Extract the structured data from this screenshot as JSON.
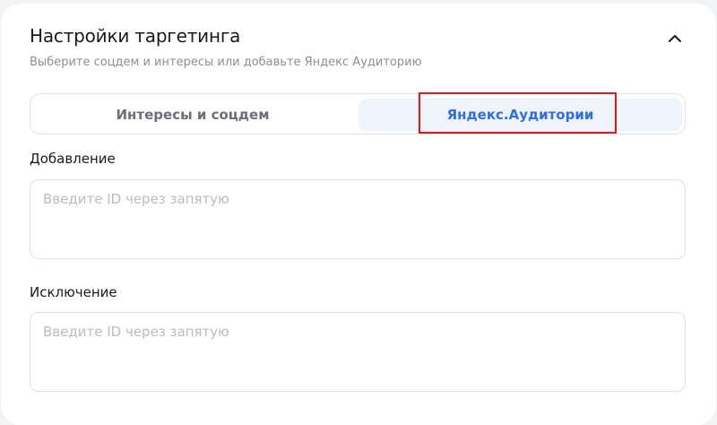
{
  "section": {
    "title": "Настройки таргетинга",
    "subtitle": "Выберите соцдем и интересы или добавьте Яндекс Аудиторию",
    "collapse_icon": "chevron-up-icon"
  },
  "tabs": [
    {
      "label": "Интересы и соцдем",
      "selected": false
    },
    {
      "label": "Яндекс.Аудитории",
      "selected": true
    }
  ],
  "fields": {
    "add": {
      "label": "Добавление",
      "placeholder": "Введите ID через запятую",
      "value": ""
    },
    "exclude": {
      "label": "Исключение",
      "placeholder": "Введите ID через запятую",
      "value": ""
    }
  },
  "colors": {
    "accent": "#2f6fe0",
    "selected_tab_bg": "#eef3fc",
    "highlight": "#e8141b"
  }
}
